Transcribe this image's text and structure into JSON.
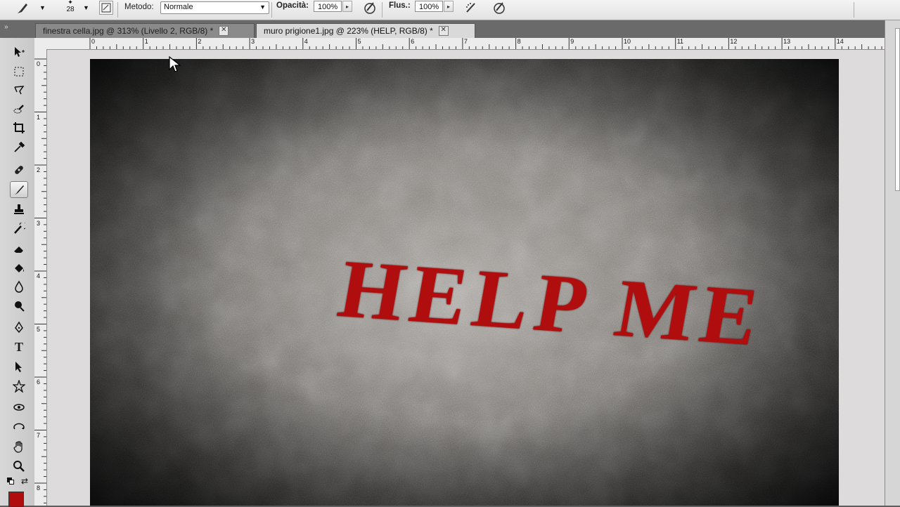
{
  "options_bar": {
    "brush_size": "28",
    "mode_label": "Metodo:",
    "mode_value": "Normale",
    "opacity_label": "Opacità:",
    "opacity_value": "100%",
    "flow_label": "Flus.:",
    "flow_value": "100%"
  },
  "tabs": [
    {
      "label": "finestra cella.jpg @ 313% (Livello 2, RGB/8) *",
      "active": false
    },
    {
      "label": "muro prigione1.jpg @ 223% (HELP, RGB/8) *",
      "active": true
    }
  ],
  "rulers": {
    "horizontal": [
      "0",
      "1",
      "2",
      "3",
      "4",
      "5",
      "6",
      "7",
      "8",
      "9",
      "10",
      "11",
      "12",
      "13",
      "14"
    ],
    "vertical": [
      "0",
      "1",
      "2",
      "3",
      "4",
      "5",
      "6",
      "7",
      "8"
    ]
  },
  "canvas": {
    "text_layer": "HELP ME",
    "text_color": "#b00e0e"
  },
  "tools": [
    "move-icon",
    "marquee-icon",
    "lasso-icon",
    "quick-select-icon",
    "crop-icon",
    "eyedropper-icon",
    "healing-icon",
    "brush-icon",
    "stamp-icon",
    "history-brush-icon",
    "eraser-icon",
    "paint-bucket-icon",
    "blur-icon",
    "dodge-icon",
    "pen-icon",
    "type-icon",
    "path-select-icon",
    "shape-icon",
    "3d-rotate-icon",
    "3d-orbit-icon",
    "hand-icon",
    "zoom-icon"
  ],
  "colors": {
    "foreground": "#b00e0e"
  }
}
